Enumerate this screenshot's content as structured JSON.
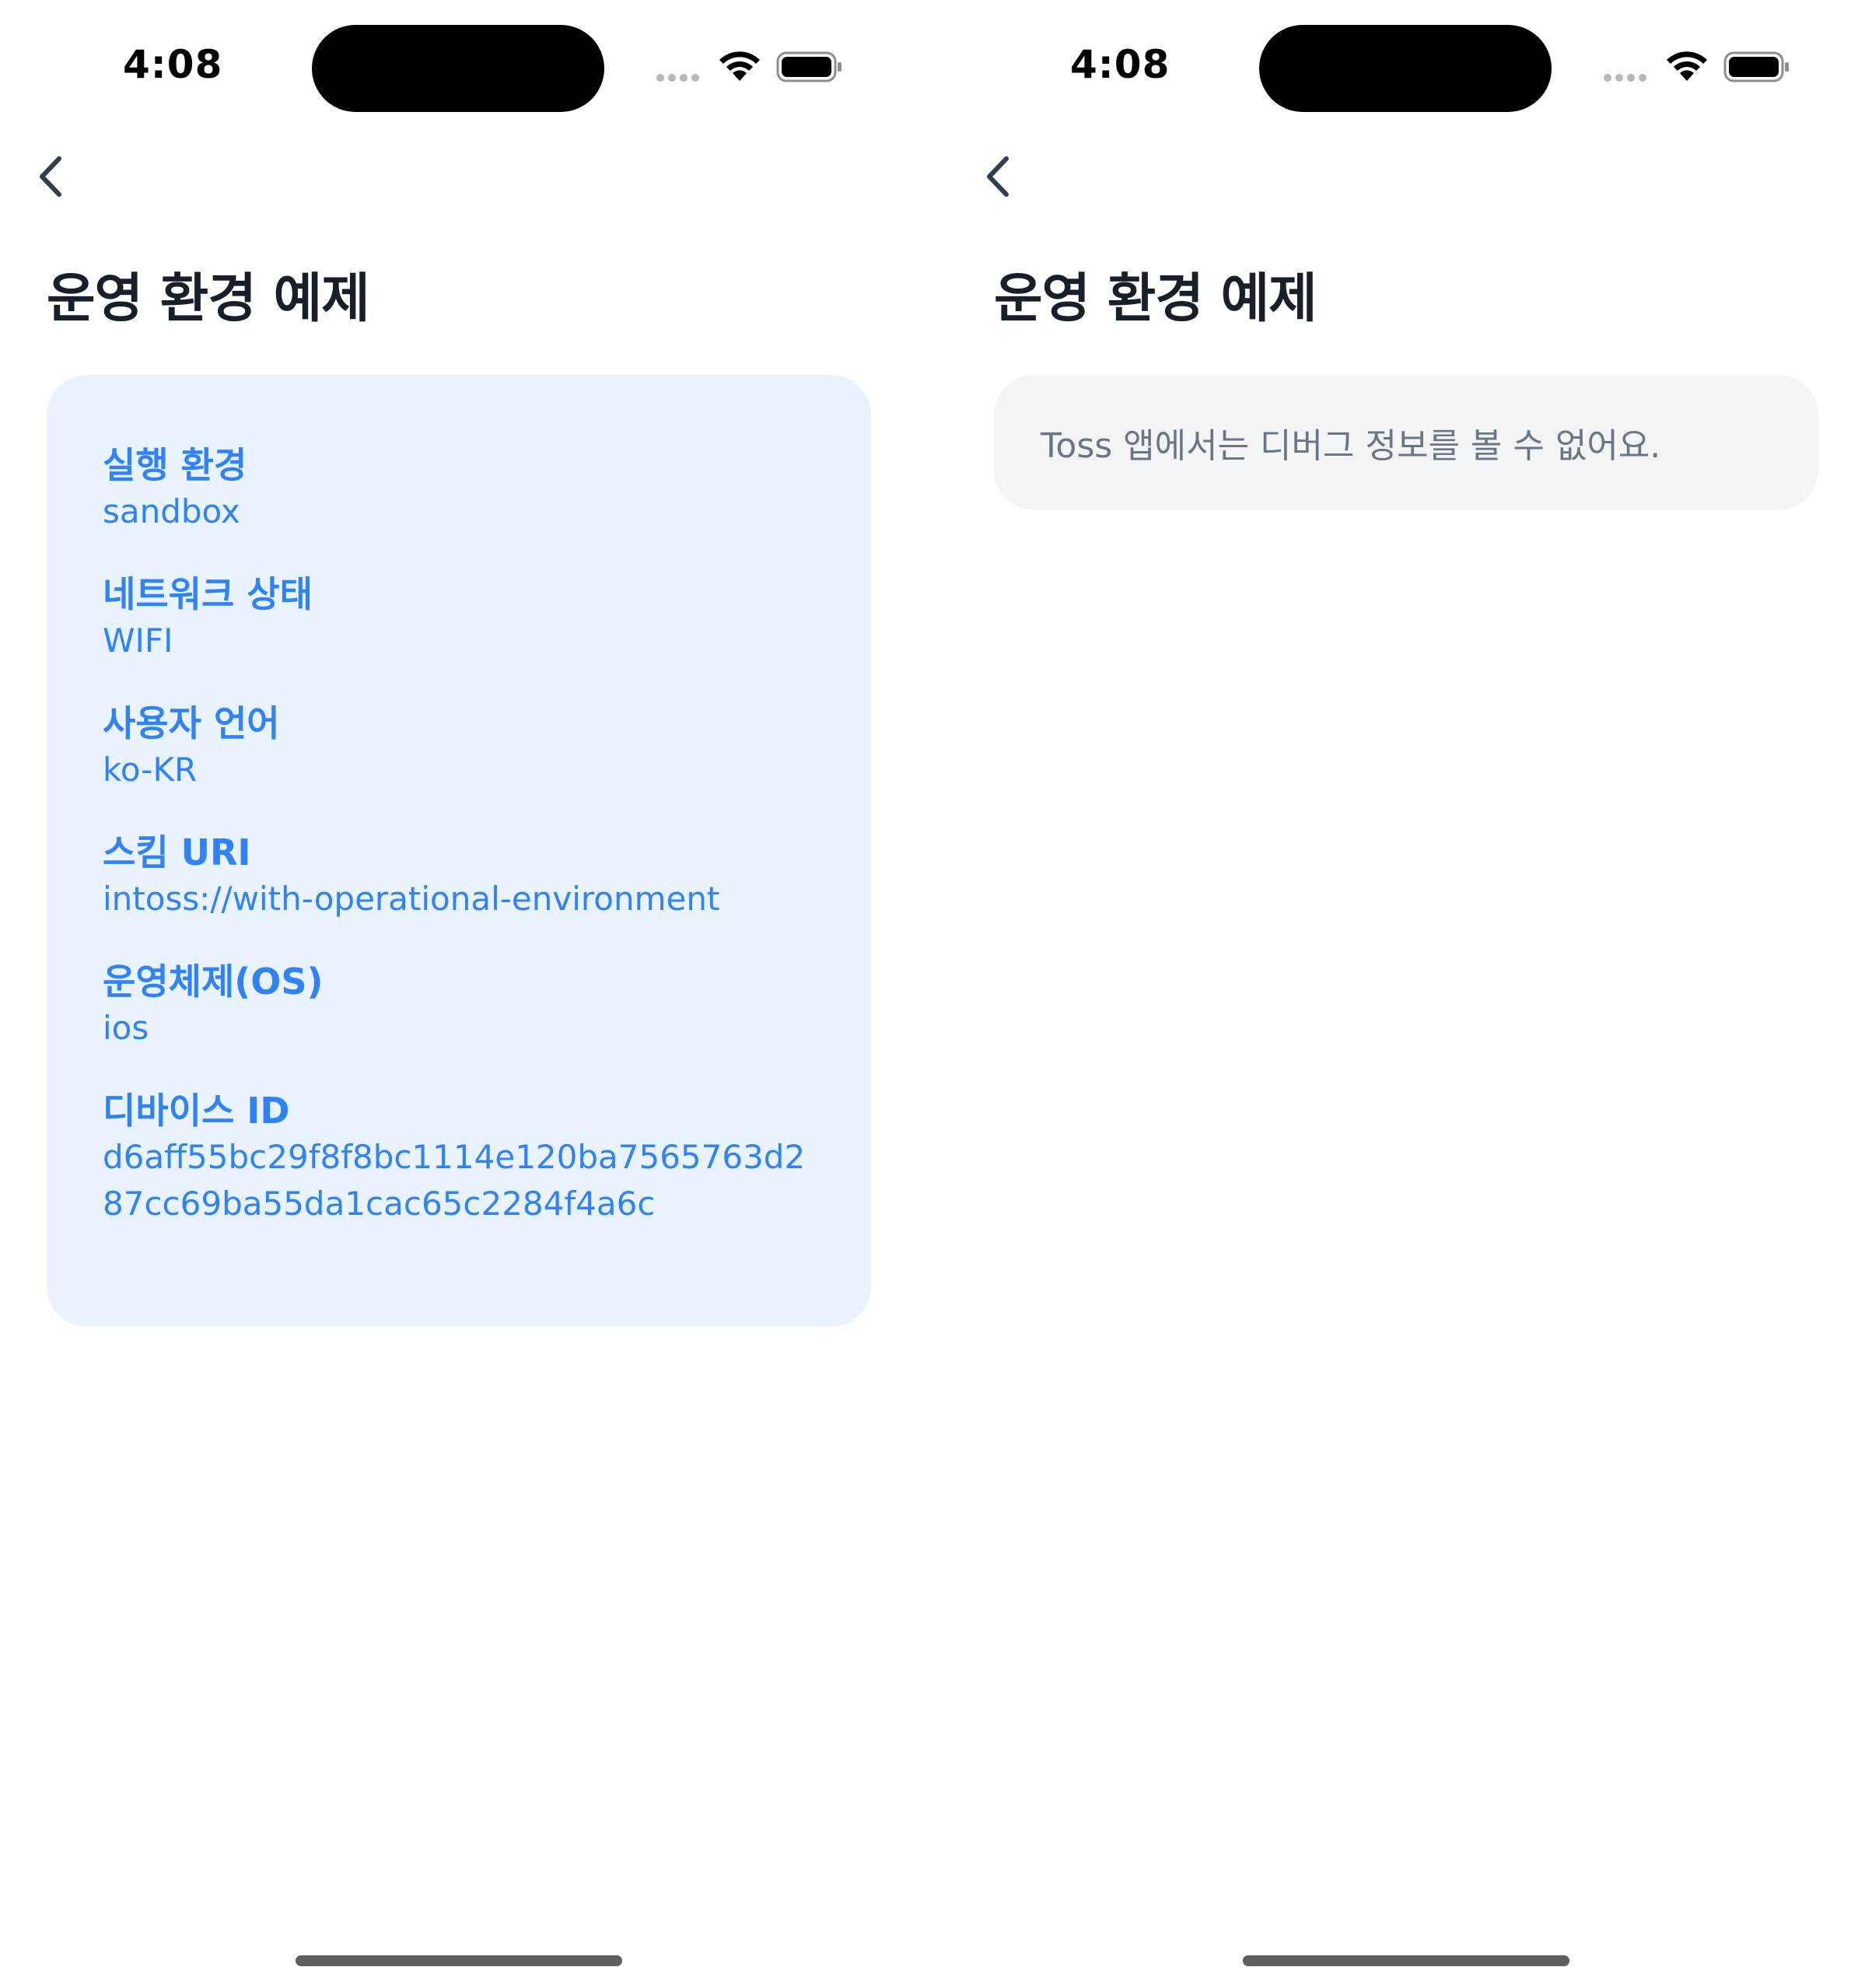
{
  "status_bar": {
    "time": "4:08"
  },
  "left_screen": {
    "title": "운영 환경 예제",
    "items": [
      {
        "label": "실행 환경",
        "value": "sandbox"
      },
      {
        "label": "네트워크 상태",
        "value": "WIFI"
      },
      {
        "label": "사용자 언어",
        "value": "ko-KR"
      },
      {
        "label": "스킴 URI",
        "value": "intoss://with-operational-environment"
      },
      {
        "label": "운영체제(OS)",
        "value": "ios"
      },
      {
        "label": "디바이스 ID",
        "value": "d6aff55bc29f8f8bc1114e120ba7565763d287cc69ba55da1cac65c2284f4a6c"
      }
    ]
  },
  "right_screen": {
    "title": "운영 환경 예제",
    "notice": "Toss 앱에서는 디버그 정보를 볼 수 없어요."
  },
  "icons": {
    "back": "chevron-left-icon",
    "wifi": "wifi-icon",
    "battery": "battery-icon",
    "signal": "cellular-signal-icon"
  },
  "colors": {
    "accent": "#3182f6",
    "card_bg": "#e8f3ff",
    "notice_bg": "#f2f4f6",
    "title": "#191f28",
    "muted_text": "#6b7684"
  }
}
